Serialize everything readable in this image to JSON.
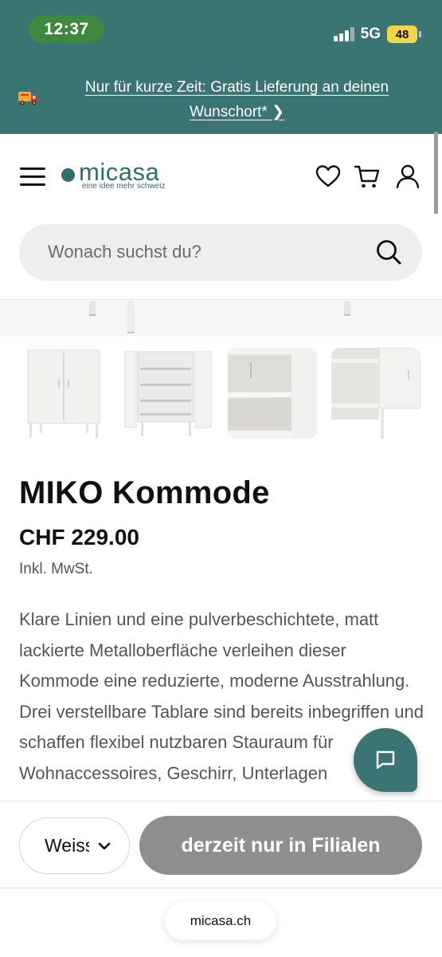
{
  "status_bar": {
    "time": "12:37",
    "network": "5G",
    "battery": "48"
  },
  "promo": {
    "text": "Nur für kurze Zeit: Gratis Lieferung an deinen Wunschort* ❯",
    "icon": "truck-icon"
  },
  "header": {
    "logo_name": "micasa",
    "logo_tagline": "eine idee mehr schweiz",
    "icons": [
      "menu-icon",
      "heart-icon",
      "cart-icon",
      "user-icon"
    ]
  },
  "search": {
    "placeholder": "Wonach suchst du?"
  },
  "product": {
    "title": "MIKO Kommode",
    "price": "CHF 229.00",
    "tax_note": "Inkl. MwSt.",
    "description": "Klare Linien und eine pulverbeschichtete, matt lackierte Metalloberfläche verleihen dieser Kommode eine reduzierte, moderne Ausstrahlung. Drei verstellbare Tablare sind bereits inbegriffen und schaffen flexibel nutzbaren Stauraum für Wohnaccessoires, Geschirr, Unterlagen"
  },
  "purchase_bar": {
    "variant": "Weiss",
    "cta_label": "derzeit nur in Filialen"
  },
  "browser": {
    "url": "micasa.ch"
  },
  "colors": {
    "brand_teal": "#3a7573",
    "cta_disabled": "#8f8f8f",
    "time_pill": "#3d8a3e",
    "battery": "#f1d54a"
  }
}
